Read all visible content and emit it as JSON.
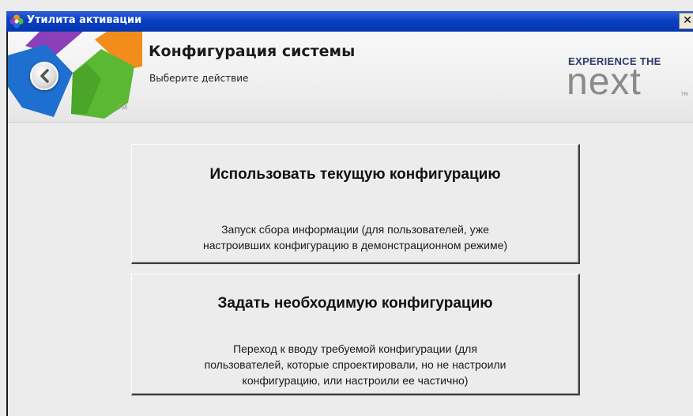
{
  "window": {
    "title": "Утилита активации",
    "close_glyph": "✕"
  },
  "header": {
    "title": "Конфигурация системы",
    "subtitle": "Выберите действие",
    "logo_tm": "TM",
    "brand_tag": "EXPERIENCE THE",
    "brand_name": "next",
    "brand_tm": "TM"
  },
  "options": [
    {
      "title": "Использовать текущую конфигурацию",
      "description_lines": [
        "Запуск сбора информации (для пользователей, уже",
        "настроивших конфигурацию в демонстрационном режиме)"
      ]
    },
    {
      "title": "Задать необходимую конфигурацию",
      "description_lines": [
        "Переход к вводу требуемой конфигурации (для",
        "пользователей, которые спроектировали, но не настроили",
        "конфигурацию, или настроили ее частично)"
      ]
    }
  ],
  "colors": {
    "titlebar": "#0a3fc4",
    "logo_blue": "#1e6fd0",
    "logo_green": "#5bb833",
    "logo_orange": "#f28c1a",
    "logo_purple": "#8b3fb8",
    "brand_text": "#2b3a6b"
  },
  "icons": {
    "app": "app-flower-icon",
    "back": "back-arrow-icon",
    "close": "close-icon"
  }
}
